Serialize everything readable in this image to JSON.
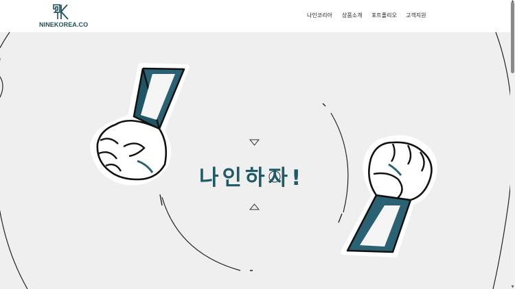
{
  "header": {
    "logo_text": "NINEKOREA.CO",
    "nav": [
      {
        "label": "나인코리아"
      },
      {
        "label": "상품소개"
      },
      {
        "label": "포트폴리오"
      },
      {
        "label": "고객지원"
      }
    ]
  },
  "hero": {
    "headline": "나인하자!"
  },
  "colors": {
    "brand": "#1d5b66",
    "background": "#efefef",
    "header": "#ffffff"
  }
}
